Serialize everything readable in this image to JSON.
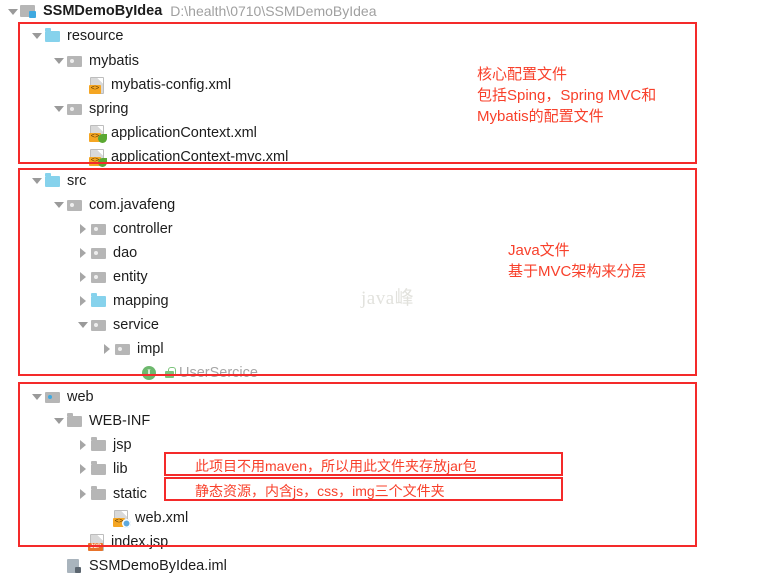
{
  "window": {
    "project_name": "SSMDemoByIdea",
    "project_path": "D:\\health\\0710\\SSMDemoByIdea"
  },
  "watermark": "java峰",
  "tree": {
    "nodes": [
      {
        "id": "resource",
        "label": "resource",
        "icon": "folder-source",
        "arrow": "down",
        "depth": 1
      },
      {
        "id": "mybatis",
        "label": "mybatis",
        "icon": "folder-package",
        "arrow": "down",
        "depth": 2
      },
      {
        "id": "mybatis-config-xml",
        "label": "mybatis-config.xml",
        "icon": "file-xml",
        "arrow": "none",
        "depth": 3
      },
      {
        "id": "spring",
        "label": "spring",
        "icon": "folder-package",
        "arrow": "down",
        "depth": 2
      },
      {
        "id": "applicationContext-xml",
        "label": "applicationContext.xml",
        "icon": "file-spring-xml",
        "arrow": "none",
        "depth": 3
      },
      {
        "id": "applicationContext-mvc",
        "label": "applicationContext-mvc.xml",
        "icon": "file-spring-xml",
        "arrow": "none",
        "depth": 3
      },
      {
        "id": "src",
        "label": "src",
        "icon": "folder-source",
        "arrow": "down",
        "depth": 1
      },
      {
        "id": "com-javafeng",
        "label": "com.javafeng",
        "icon": "folder-package",
        "arrow": "down",
        "depth": 2
      },
      {
        "id": "controller",
        "label": "controller",
        "icon": "folder-package",
        "arrow": "right",
        "depth": 3
      },
      {
        "id": "dao",
        "label": "dao",
        "icon": "folder-package",
        "arrow": "right",
        "depth": 3
      },
      {
        "id": "entity",
        "label": "entity",
        "icon": "folder-package",
        "arrow": "right",
        "depth": 3
      },
      {
        "id": "mapping",
        "label": "mapping",
        "icon": "folder-source",
        "arrow": "right",
        "depth": 3
      },
      {
        "id": "service",
        "label": "service",
        "icon": "folder-package",
        "arrow": "down",
        "depth": 3
      },
      {
        "id": "impl",
        "label": "impl",
        "icon": "folder-package",
        "arrow": "right",
        "depth": 4
      },
      {
        "id": "UserSercice",
        "label": "UserSercice",
        "icon": "interface-lock",
        "arrow": "none",
        "depth": 4,
        "muted": true
      },
      {
        "id": "web",
        "label": "web",
        "icon": "folder-web",
        "arrow": "down",
        "depth": 1
      },
      {
        "id": "WEB-INF",
        "label": "WEB-INF",
        "icon": "folder-gray",
        "arrow": "down",
        "depth": 2
      },
      {
        "id": "jsp",
        "label": "jsp",
        "icon": "folder-gray",
        "arrow": "right",
        "depth": 3
      },
      {
        "id": "lib",
        "label": "lib",
        "icon": "folder-gray",
        "arrow": "right",
        "depth": 3
      },
      {
        "id": "static",
        "label": "static",
        "icon": "folder-gray",
        "arrow": "right",
        "depth": 3
      },
      {
        "id": "web-xml",
        "label": "web.xml",
        "icon": "file-web-xml",
        "arrow": "none",
        "depth": 3
      },
      {
        "id": "index-jsp",
        "label": "index.jsp",
        "icon": "file-jsp",
        "arrow": "none",
        "depth": 2
      },
      {
        "id": "SSMDemoByIdea-iml",
        "label": "SSMDemoByIdea.iml",
        "icon": "file-module",
        "arrow": "none",
        "depth": 1
      }
    ]
  },
  "annotations": {
    "resource_note": "核心配置文件\n包括Sping，Spring MVC和\nMybatis的配置文件",
    "src_note": "Java文件\n基于MVC架构来分层",
    "lib_note": "此项目不用maven，所以用此文件夹存放jar包",
    "static_note": "静态资源，内含js，css，img三个文件夹"
  },
  "colors": {
    "annotation_red": "#f8402b",
    "box_border": "#f42a2a",
    "source_folder_blue": "#86d2ec",
    "folder_gray": "#b6b6b6",
    "xml_badge_orange": "#f5a623",
    "spring_leaf_green": "#5aa832",
    "jsp_badge_orange": "#e8732a",
    "interface_green": "#6db86d"
  }
}
